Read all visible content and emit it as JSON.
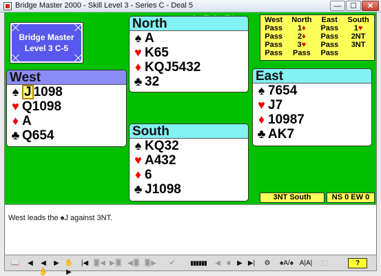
{
  "window": {
    "title": "Bridge Master 2000 - Skill Level 3 - Series C - Deal 5",
    "min": "—",
    "max": "☐",
    "close": "✕"
  },
  "background_text": "AaE AaEt",
  "info": {
    "line1": "Bridge Master",
    "line2": "Level 3 C-5"
  },
  "hands": {
    "north": {
      "name": "North",
      "spades": "A",
      "hearts": "K65",
      "diamonds": "KQJ5432",
      "clubs": "32"
    },
    "west": {
      "name": "West",
      "spades_lead": "J",
      "spades_rest": "1098",
      "hearts": "Q1098",
      "diamonds": "A",
      "clubs": "Q654"
    },
    "east": {
      "name": "East",
      "spades": "7654",
      "hearts": "J7",
      "diamonds": "10987",
      "clubs": "AK7"
    },
    "south": {
      "name": "South",
      "spades": "KQ32",
      "hearts": "A432",
      "diamonds": "6",
      "clubs": "J1098"
    }
  },
  "suits": {
    "spade": "♠",
    "heart": "♥",
    "diamond": "♦",
    "club": "♣"
  },
  "auction": {
    "headers": [
      "West",
      "North",
      "East",
      "South"
    ],
    "rows": [
      [
        "Pass",
        "1♦",
        "Pass",
        "1♥"
      ],
      [
        "Pass",
        "2♦",
        "Pass",
        "2NT"
      ],
      [
        "Pass",
        "3♥",
        "Pass",
        "3NT"
      ],
      [
        "Pass",
        "Pass",
        "Pass",
        ""
      ]
    ]
  },
  "contract": "3NT South",
  "score": "NS 0 EW 0",
  "message": "West leads the ♠J against 3NT.",
  "toolbar": {
    "book": "📖",
    "prev_board": "◀",
    "hand_back": "◀✋",
    "play": "▶",
    "hand_fwd": "✋▶",
    "rewind": "|◀",
    "card_back": "🂠◀",
    "card_fwd": "▶🂠",
    "undo": "◀🂠",
    "redo": "🂠▶",
    "check": "✔",
    "bars": "▮▮▮▮▮▮",
    "back_trick": "◀",
    "stop": "■",
    "fwd_trick": "▶",
    "end": "▶|",
    "settings": "⚙",
    "aj1": "♠A/♠",
    "aj2": "A|A|",
    "aj3": "⬚",
    "help": "?"
  }
}
